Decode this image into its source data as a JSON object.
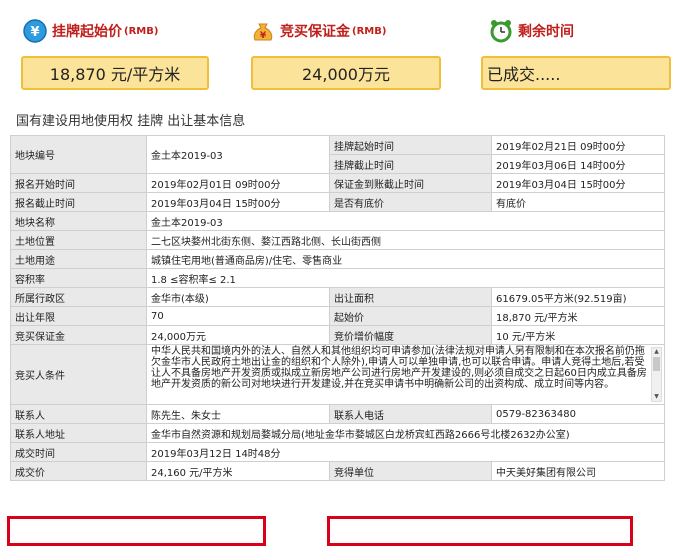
{
  "headers": {
    "start_price_label": "挂牌起始价",
    "start_price_unit": "(RMB)",
    "deposit_label": "竞买保证金",
    "deposit_unit": "(RMB)",
    "remaining_label": "剩余时间"
  },
  "summary": {
    "start_price": "18,870 元/平方米",
    "deposit": "24,000万元",
    "remaining": "已成交....."
  },
  "section_title": "国有建设用地使用权 挂牌 出让基本信息",
  "rows": {
    "plot_no_label": "地块编号",
    "plot_no": "金土本2019-03",
    "listing_start_label": "挂牌起始时间",
    "listing_start": "2019年02月21日 09时00分",
    "listing_end_label": "挂牌截止时间",
    "listing_end": "2019年03月06日 14时00分",
    "signup_start_label": "报名开始时间",
    "signup_start": "2019年02月01日 09时00分",
    "deposit_deadline_label": "保证金到账截止时间",
    "deposit_deadline": "2019年03月04日 15时00分",
    "signup_end_label": "报名截止时间",
    "signup_end": "2019年03月04日 15时00分",
    "reserve_label": "是否有底价",
    "reserve": "有底价",
    "plot_name_label": "地块名称",
    "plot_name": "金土本2019-03",
    "location_label": "土地位置",
    "location": "二七区块婺州北街东侧、婺江西路北侧、长山街西侧",
    "usage_label": "土地用途",
    "usage": "城镇住宅用地(普通商品房)/住宅、零售商业",
    "far_label": "容积率",
    "far": "1.8 ≤容积率≤ 2.1",
    "district_label": "所属行政区",
    "district": "金华市(本级)",
    "area_label": "出让面积",
    "area": "61679.05平方米(92.519亩)",
    "years_label": "出让年限",
    "years": "70",
    "start_price_label": "起始价",
    "start_price": "18,870 元/平方米",
    "deposit_label": "竞买保证金",
    "deposit": "24,000万元",
    "increment_label": "竞价增价幅度",
    "increment": "10 元/平方米",
    "conditions_label": "竞买人条件",
    "conditions": "中华人民共和国境内外的法人、自然人和其他组织均可申请参加(法律法规对申请人另有限制和在本次报名前仍拖欠金华市人民政府土地出让金的组织和个人除外),申请人可以单独申请,也可以联合申请。申请人竞得土地后,若受让人不具备房地产开发资质或拟成立新房地产公司进行房地产开发建设的,则必须自成交之日起60日内成立具备房地产开发资质的新公司对地块进行开发建设,并在竞买申请书中明确新公司的出资构成、成立时间等内容。",
    "contact_label": "联系人",
    "contact": "陈先生、朱女士",
    "phone_label": "联系人电话",
    "phone": "0579-82363480",
    "address_label": "联系人地址",
    "address": "金华市自然资源和规划局婺城分局(地址金华市婺城区白龙桥宾虹西路2666号北楼2632办公室)",
    "deal_time_label": "成交时间",
    "deal_time": "2019年03月12日 14时48分",
    "deal_price_label": "成交价",
    "deal_price": "24,160 元/平方米",
    "winner_label": "竞得单位",
    "winner": "中天美好集团有限公司"
  },
  "colors": {
    "header_red": "#c0201c",
    "box_fill": "#fbe39a",
    "box_border": "#f0bf3a",
    "highlight_red": "#d9001b"
  },
  "icons": [
    "money-coin-icon",
    "money-bag-icon",
    "alarm-clock-icon"
  ]
}
